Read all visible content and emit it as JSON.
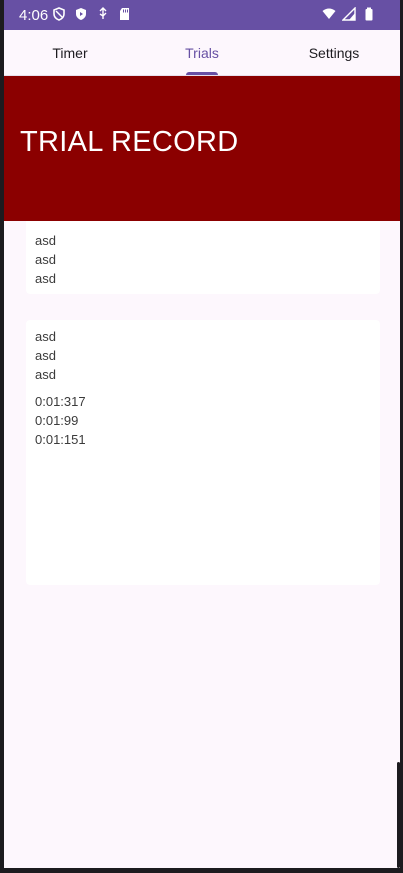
{
  "status_bar": {
    "time": "4:06",
    "left_icons": [
      "vpn-shield-icon",
      "play-protect-icon",
      "usb-debug-icon",
      "sd-card-icon"
    ],
    "right_icons": [
      "wifi-icon",
      "cellular-signal-icon",
      "battery-icon"
    ],
    "color": "#6750a4"
  },
  "tabs": [
    {
      "label": "Timer",
      "active": false
    },
    {
      "label": "Trials",
      "active": true
    },
    {
      "label": "Settings",
      "active": false
    }
  ],
  "hero": {
    "title": "TRIAL RECORD",
    "color": "#8b0000"
  },
  "cards": [
    {
      "names": [
        "asd",
        "asd",
        "asd"
      ]
    },
    {
      "names": [
        "asd",
        "asd",
        "asd"
      ],
      "times": [
        "0:01:317",
        "0:01:99",
        "0:01:151"
      ]
    }
  ]
}
